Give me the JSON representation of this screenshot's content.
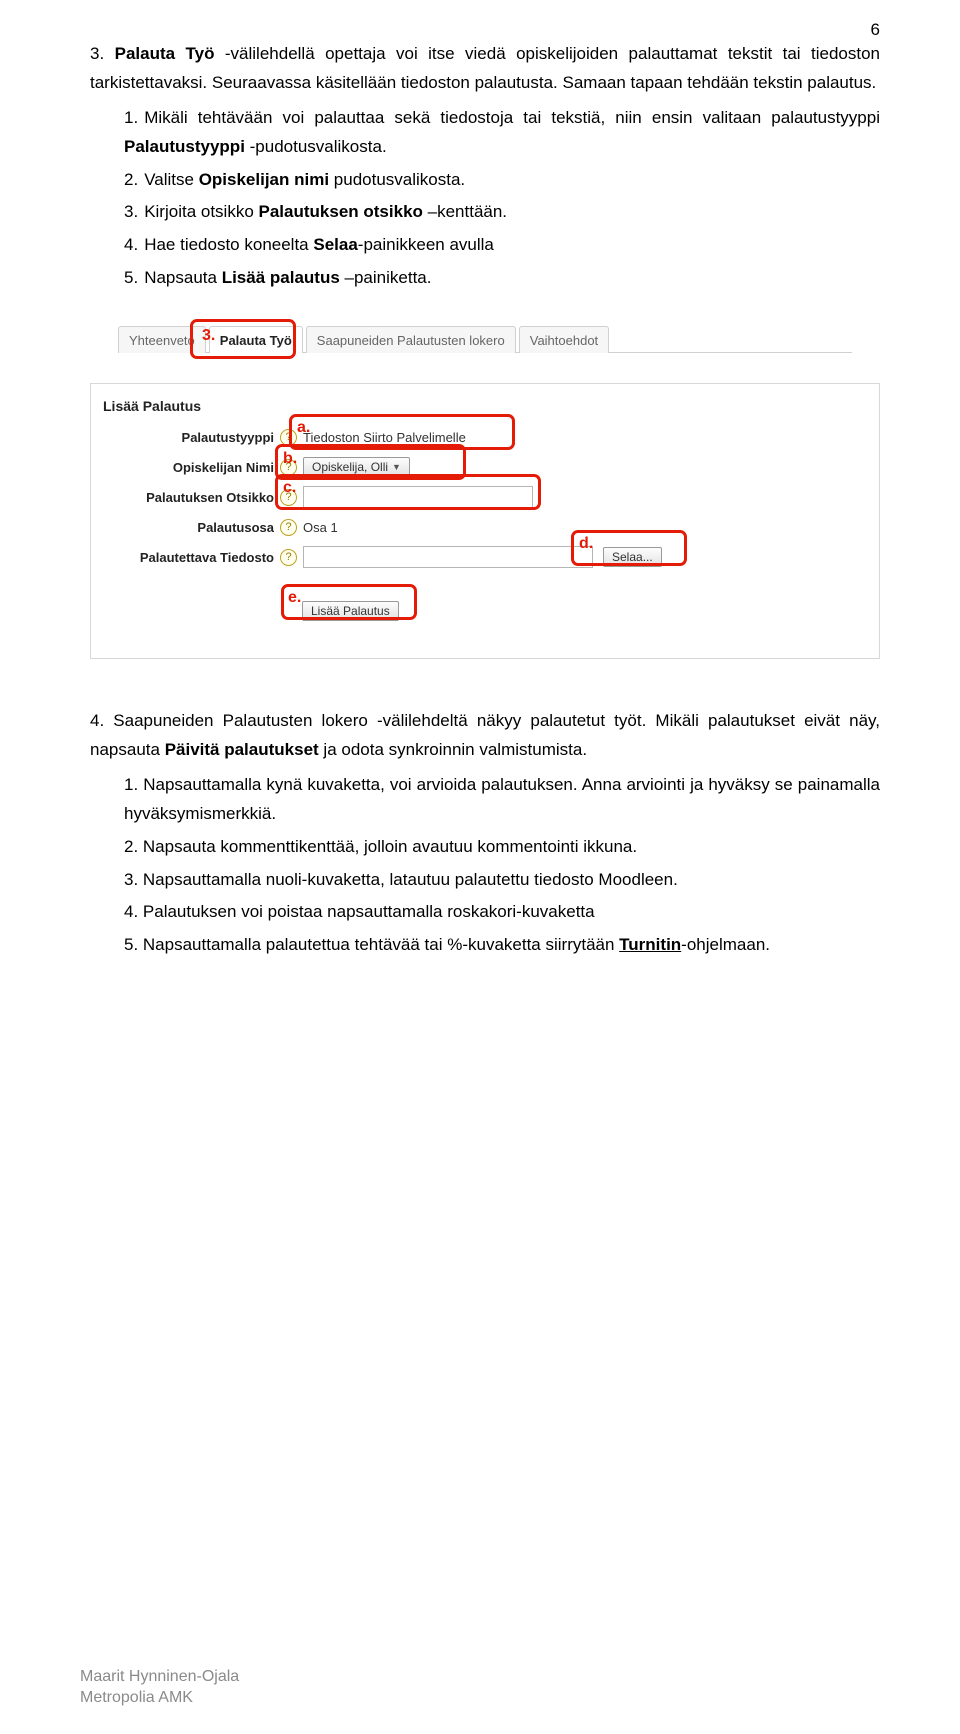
{
  "page_number": "6",
  "section3": {
    "intro_pre": "3. ",
    "intro_b1": "Palauta Työ",
    "intro_mid": " -välilehdellä opettaja voi itse viedä opiskelijoiden palauttamat tekstit tai tiedoston tarkistettavaksi. Seuraavassa käsitellään tiedoston palautusta. Samaan tapaan tehdään tekstin palautus.",
    "items": [
      {
        "n": "1.",
        "pre": "Mikäli tehtävään voi palauttaa sekä tiedostoja tai tekstiä, niin ensin valitaan palautustyyppi ",
        "b": "Palautustyyppi",
        "post": " -pudotusvalikosta."
      },
      {
        "n": "2.",
        "pre": "Valitse ",
        "b": "Opiskelijan nimi",
        "post": " pudotusvalikosta."
      },
      {
        "n": "3.",
        "pre": "Kirjoita otsikko ",
        "b": "Palautuksen otsikko",
        "post": " –kenttään."
      },
      {
        "n": "4.",
        "pre": "Hae tiedosto koneelta ",
        "b": "Selaa",
        "post": "-painikkeen avulla"
      },
      {
        "n": "5.",
        "pre": "Napsauta ",
        "b": "Lisää palautus",
        "post": " –painiketta."
      }
    ]
  },
  "screenshot": {
    "tabs": [
      "Yhteenveto",
      "Palauta Työ",
      "Saapuneiden Palautusten lokero",
      "Vaihtoehdot"
    ],
    "active_tab_index": 1,
    "tab_marker": "3.",
    "form_title": "Lisää Palautus",
    "rows": {
      "type_label": "Palautustyyppi",
      "type_value": "Tiedoston Siirto Palvelimelle",
      "student_label": "Opiskelijan Nimi",
      "student_value": "Opiskelija, Olli",
      "title_label": "Palautuksen Otsikko",
      "part_label": "Palautusosa",
      "part_value": "Osa 1",
      "file_label": "Palautettava Tiedosto",
      "browse_btn": "Selaa...",
      "submit_btn": "Lisää Palautus"
    },
    "markers": {
      "a": "a.",
      "b": "b.",
      "c": "c.",
      "d": "d.",
      "e": "e."
    }
  },
  "section4": {
    "intro_pre": "4. Saapuneiden Palautusten lokero -välilehdeltä näkyy palautetut työt. Mikäli palautukset eivät näy, napsauta ",
    "intro_b": "Päivitä palautukset",
    "intro_post": " ja odota synkroinnin valmistumista.",
    "items": [
      "1. Napsauttamalla kynä kuvaketta, voi arvioida palautuksen. Anna arviointi ja hyväksy se painamalla hyväksymismerkkiä.",
      "2. Napsauta kommenttikenttää, jolloin avautuu kommentointi ikkuna.",
      "3. Napsauttamalla nuoli-kuvaketta, latautuu palautettu tiedosto Moodleen.",
      "4. Palautuksen voi poistaa napsauttamalla roskakori-kuvaketta"
    ],
    "item5_pre": "5. Napsauttamalla palautettua tehtävää tai %-kuvaketta siirrytään ",
    "item5_link": "Turnitin",
    "item5_post": "-ohjelmaan."
  },
  "footer": {
    "l1": "Maarit Hynninen-Ojala",
    "l2": "Metropolia AMK"
  }
}
